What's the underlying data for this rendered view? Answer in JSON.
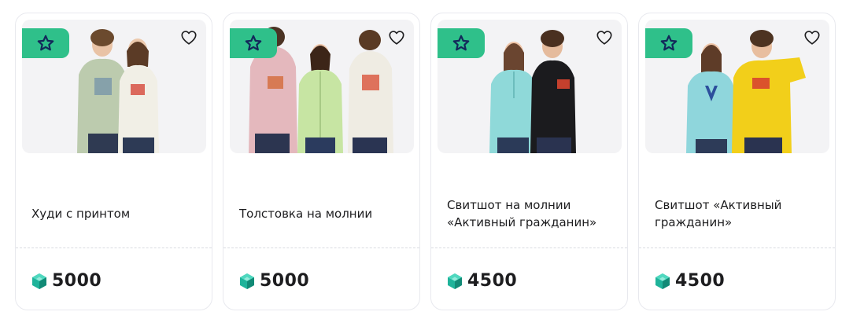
{
  "products": [
    {
      "title": "Худи с принтом",
      "price": "5000",
      "badge_icon": "star-icon",
      "favorite_icon": "heart-icon",
      "currency_icon": "gem-icon",
      "image_alt": "hoodie-models-photo",
      "garment_colors": [
        "#bccbae",
        "#f1efe6"
      ]
    },
    {
      "title": "Толстовка на молнии",
      "price": "5000",
      "badge_icon": "star-icon",
      "favorite_icon": "heart-icon",
      "currency_icon": "gem-icon",
      "image_alt": "zip-hoodie-models-photo",
      "garment_colors": [
        "#e4b8bd",
        "#c7e5a3",
        "#efece3"
      ]
    },
    {
      "title": "Свитшот на молнии «Активный гражданин»",
      "price": "4500",
      "badge_icon": "star-icon",
      "favorite_icon": "heart-icon",
      "currency_icon": "gem-icon",
      "image_alt": "zip-sweatshirt-models-photo",
      "garment_colors": [
        "#8fd9d9",
        "#1b1b1e"
      ]
    },
    {
      "title": "Свитшот «Активный гражданин»",
      "price": "4500",
      "badge_icon": "star-icon",
      "favorite_icon": "heart-icon",
      "currency_icon": "gem-icon",
      "image_alt": "sweatshirt-models-photo",
      "garment_colors": [
        "#8fd6dc",
        "#f2cf1a"
      ]
    }
  ],
  "colors": {
    "badge_bg": "#2fc08a",
    "star_stroke": "#13285a",
    "gem": "#1fb39a",
    "text": "#1d1d1f",
    "card_border": "#e8e9ee"
  }
}
